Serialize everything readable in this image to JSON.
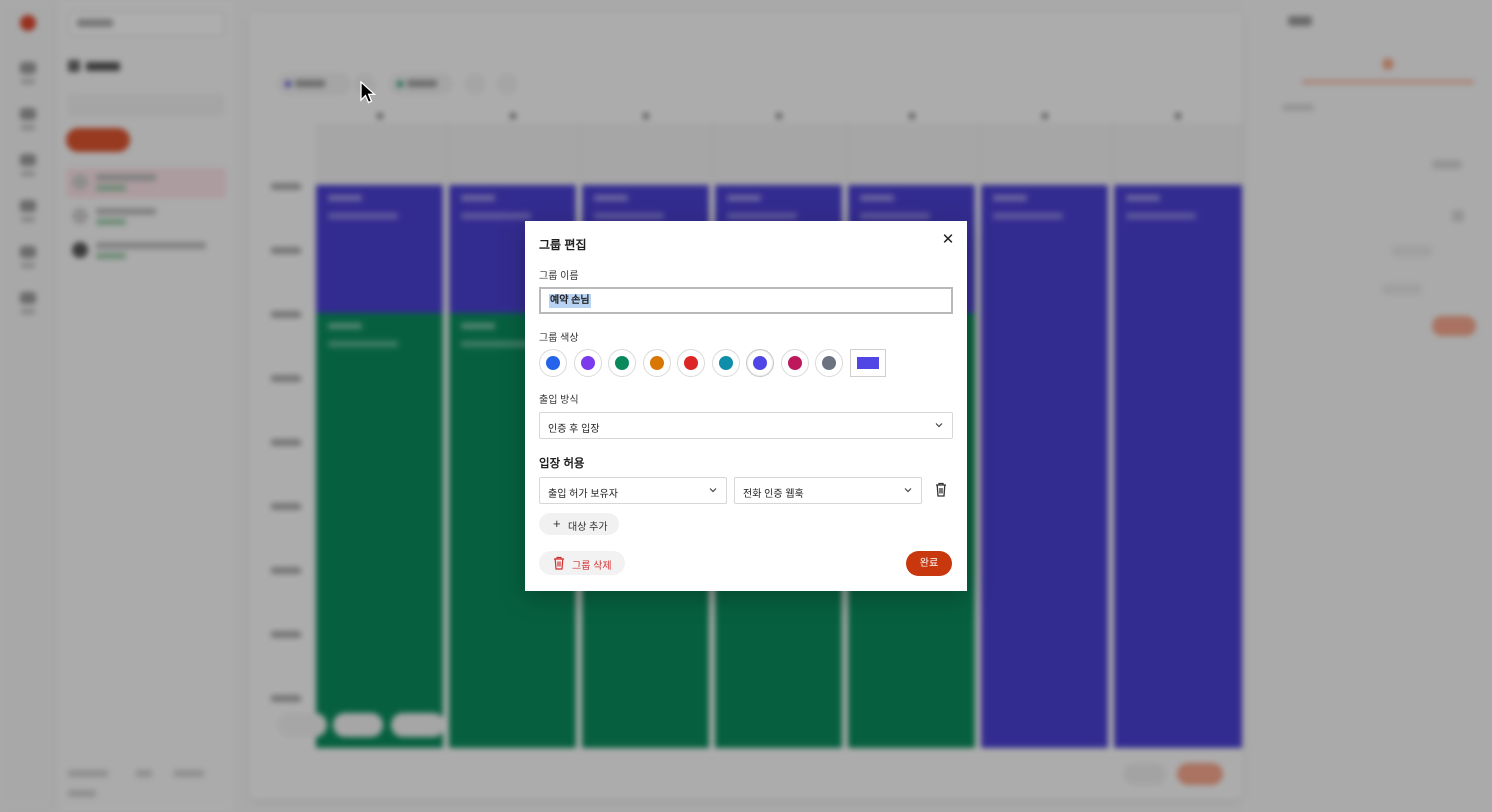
{
  "modal": {
    "title": "그룹 편집",
    "close_glyph": "✕",
    "name_label": "그룹 이름",
    "name_value": "예약 손님",
    "color_label": "그룹 색상",
    "colors": [
      "#2563eb",
      "#7c3aed",
      "#0a8a5c",
      "#d97706",
      "#dc2626",
      "#0e8ea8",
      "#4f46e5",
      "#be185d",
      "#6b7280"
    ],
    "selected_color": "#4f46e5",
    "access_label": "출입 방식",
    "access_value": "인증 후 입장",
    "entry_section_title": "입장 허용",
    "entry_target": "출입 허가 보유자",
    "entry_method": "전화 인증 웹훅",
    "add_target_label": "대상 추가",
    "delete_group_label": "그룹 삭제",
    "done_label": "완료"
  },
  "background": {
    "accent_colors": {
      "booking_group": "#4a3fcf",
      "second_group": "#0a8a5c",
      "brand": "#d9542f"
    }
  }
}
